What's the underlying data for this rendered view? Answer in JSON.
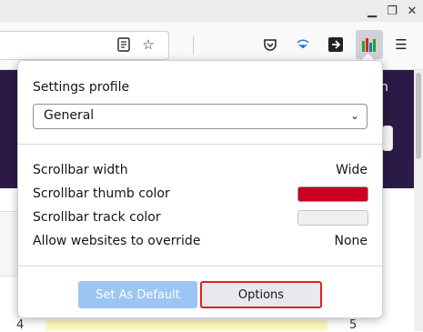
{
  "popup": {
    "title": "Settings profile",
    "profile_select": {
      "selected": "General"
    },
    "rows": [
      {
        "label": "Scrollbar width",
        "value": "Wide"
      },
      {
        "label": "Scrollbar thumb color",
        "swatch_color": "#cc0020"
      },
      {
        "label": "Scrollbar track color",
        "swatch_color": "#efefef"
      },
      {
        "label": "Allow websites to override",
        "value": "None"
      }
    ],
    "buttons": {
      "set_default": "Set As Default",
      "options": "Options"
    }
  },
  "page": {
    "partial_text_right": "n",
    "list_numbers": [
      "4",
      "5"
    ]
  },
  "colors": {
    "accent_blue": "#9cc5f4",
    "highlight_red": "#e02020",
    "extension_icon_bg": "#d0d0d7"
  },
  "icons": [
    "reader-view-icon",
    "bookmark-star-icon",
    "pocket-icon",
    "hotspot-icon",
    "forward-arrow-icon",
    "scrollbar-extension-icon",
    "hamburger-menu-icon",
    "minimize-icon",
    "restore-icon",
    "close-icon"
  ]
}
